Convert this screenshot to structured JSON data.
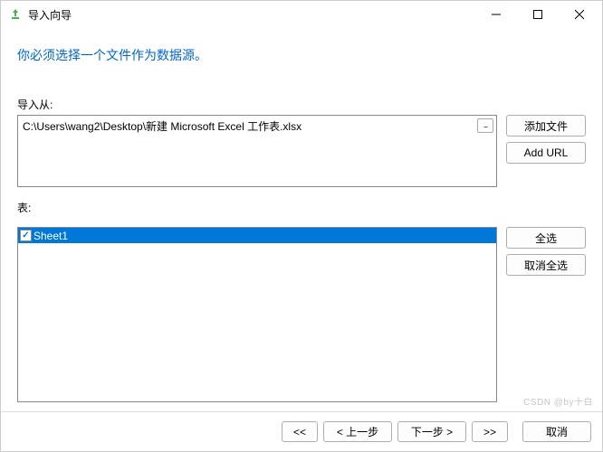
{
  "titlebar": {
    "title": "导入向导"
  },
  "heading": "你必须选择一个文件作为数据源。",
  "import_from": {
    "label": "导入从:",
    "path": "C:\\Users\\wang2\\Desktop\\新建 Microsoft Excel 工作表.xlsx",
    "browse": "..."
  },
  "buttons": {
    "add_file": "添加文件",
    "add_url": "Add URL",
    "select_all": "全选",
    "deselect_all": "取消全选"
  },
  "tables": {
    "label": "表:",
    "items": [
      {
        "name": "Sheet1",
        "checked": true,
        "selected": true
      }
    ]
  },
  "footer": {
    "first": "<<",
    "prev": "< 上一步",
    "next": "下一步 >",
    "last": ">>",
    "cancel": "取消"
  },
  "watermark": "CSDN @by十白"
}
